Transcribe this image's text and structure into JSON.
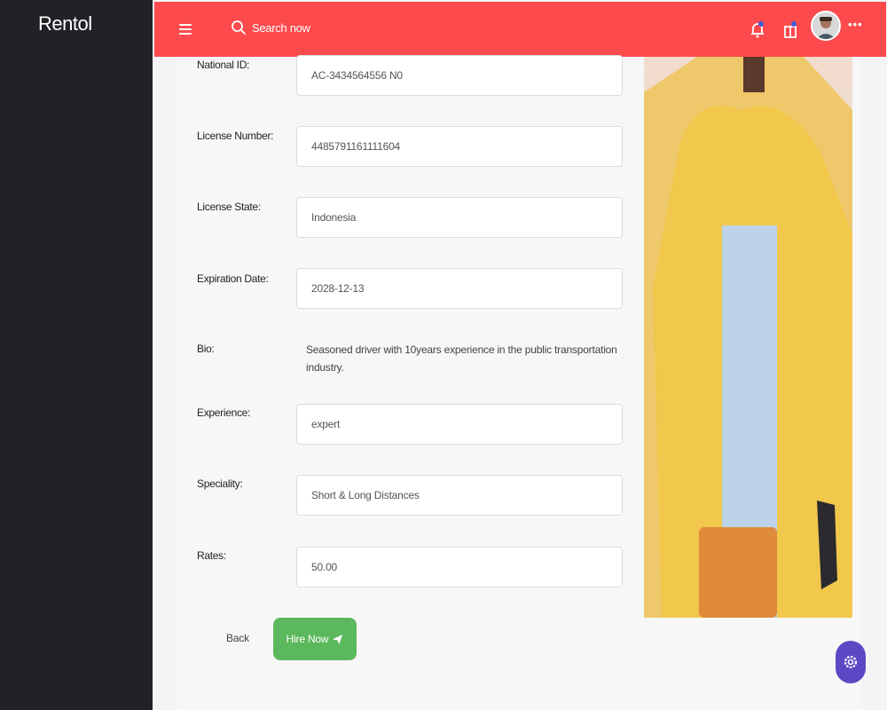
{
  "app": {
    "brand": "Rentol"
  },
  "header": {
    "search_label": "Search now",
    "more_label": "•••"
  },
  "form": {
    "fields": [
      {
        "label": "National ID:",
        "value": "AC-3434564556 N0"
      },
      {
        "label": "License Number:",
        "value": "4485791161111604"
      },
      {
        "label": "License State:",
        "value": "Indonesia"
      },
      {
        "label": "Expiration Date:",
        "value": "2028-12-13"
      }
    ],
    "bio": {
      "label": "Bio:",
      "text": "Seasoned driver with 10years experience in the public transportation industry."
    },
    "fields2": [
      {
        "label": "Experience:",
        "value": "expert"
      },
      {
        "label": "Speciality:",
        "value": "Short & Long Distances"
      },
      {
        "label": "Rates:",
        "value": "50.00"
      }
    ]
  },
  "actions": {
    "back_label": "Back",
    "hire_label": "Hire Now"
  },
  "colors": {
    "header": "#fc4a4d",
    "sidebar": "#212226",
    "hire": "#5cb85c",
    "settings": "#5b48c4"
  }
}
